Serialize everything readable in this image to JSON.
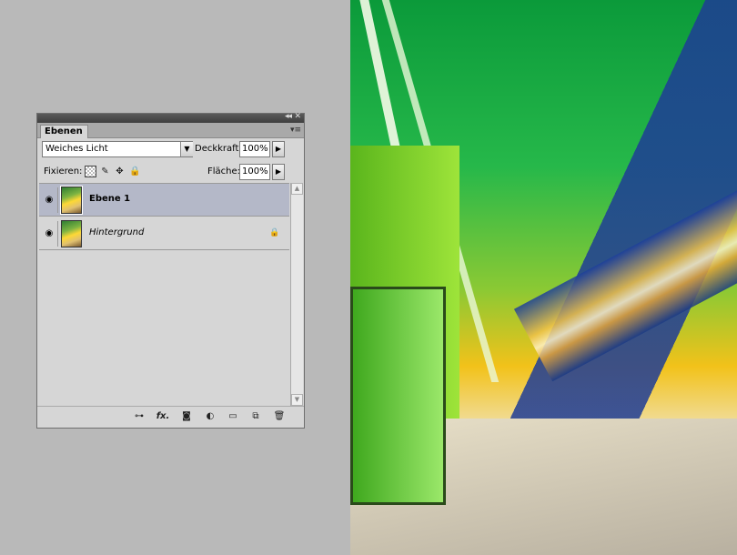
{
  "layers_panel": {
    "tab_label": "Ebenen",
    "collapse_glyph": "◂◂",
    "close_glyph": "✕",
    "menu_glyph": "▾≡",
    "blend_mode": "Weiches Licht",
    "opacity_label": "Deckkraft:",
    "opacity_value": "100%",
    "lock_label": "Fixieren:",
    "fill_label": "Fläche:",
    "fill_value": "100%",
    "layers": [
      {
        "name": "Ebene 1",
        "selected": true,
        "visible": true,
        "locked": false
      },
      {
        "name": "Hintergrund",
        "selected": false,
        "visible": true,
        "locked": true
      }
    ],
    "bottom_icons": [
      "link-icon",
      "fx-icon",
      "mask-icon",
      "adjustment-icon",
      "folder-icon",
      "new-layer-icon",
      "trash-icon"
    ],
    "fx_label": "fx."
  },
  "icons": {
    "eye": "◉",
    "lock": "🔒",
    "arrow_down": "▼",
    "arrow_right": "▶",
    "brush": "✎",
    "move": "✥",
    "link": "⊶",
    "mask": "◙",
    "adjust": "◐",
    "folder": "▭",
    "new": "⧉",
    "trash": "🗑",
    "scroll_up": "▲",
    "scroll_down": "▼"
  }
}
